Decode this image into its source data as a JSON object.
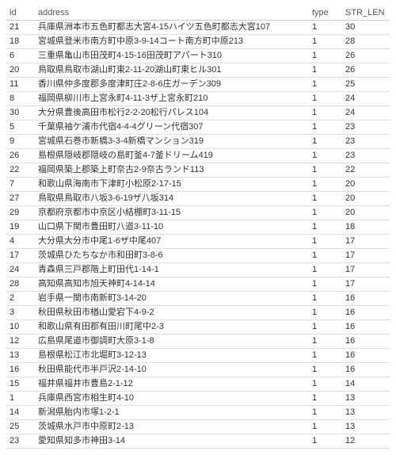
{
  "headers": {
    "id": "id",
    "address": "address",
    "type": "type",
    "strlen": "STR_LEN"
  },
  "rows": [
    {
      "id": "21",
      "address": "兵庫県洲本市五色町都志大宮4-15ハイツ五色町都志大宮107",
      "type": "1",
      "strlen": "30"
    },
    {
      "id": "18",
      "address": "宮城県登米市南方町中原3-9-14コート南方町中原213",
      "type": "1",
      "strlen": "28"
    },
    {
      "id": "6",
      "address": "三重県亀山市田茂町4-15-16田茂町アパート310",
      "type": "1",
      "strlen": "26"
    },
    {
      "id": "20",
      "address": "鳥取県鳥取市湖山町東2-11-20湖山町東ヒル301",
      "type": "1",
      "strlen": "26"
    },
    {
      "id": "11",
      "address": "香川県仲多度郡多度津町庄2-8-6庄ガーデン309",
      "type": "1",
      "strlen": "25"
    },
    {
      "id": "8",
      "address": "福岡県柳川市上宮永町4-11-3ザ上宮永町210",
      "type": "1",
      "strlen": "24"
    },
    {
      "id": "30",
      "address": "大分県豊後高田市松行2-2-20松行パレス104",
      "type": "1",
      "strlen": "24"
    },
    {
      "id": "5",
      "address": "千葉県袖ケ浦市代宿4-4-4グリーン代宿307",
      "type": "1",
      "strlen": "23"
    },
    {
      "id": "9",
      "address": "宮城県石巻市新橋3-3-4新橋マンション319",
      "type": "1",
      "strlen": "23"
    },
    {
      "id": "26",
      "address": "島根県隠岐郡隠岐の島町釜4-7釜ドリーム419",
      "type": "1",
      "strlen": "23"
    },
    {
      "id": "22",
      "address": "福岡県築上郡築上町奈古2-9奈古ランド113",
      "type": "1",
      "strlen": "22"
    },
    {
      "id": "7",
      "address": "和歌山県海南市下津町小松原2-17-15",
      "type": "1",
      "strlen": "20"
    },
    {
      "id": "27",
      "address": "鳥取県鳥取市八坂3-6-19ザ八坂314",
      "type": "1",
      "strlen": "20"
    },
    {
      "id": "29",
      "address": "京都府京都市中京区小結棚町3-11-15",
      "type": "1",
      "strlen": "20"
    },
    {
      "id": "19",
      "address": "山口県下関市豊田町八道3-11-10",
      "type": "1",
      "strlen": "18"
    },
    {
      "id": "4",
      "address": "大分県大分市中尾1-6ザ中尾407",
      "type": "1",
      "strlen": "17"
    },
    {
      "id": "17",
      "address": "茨城県ひたちなか市和田町3-8-6",
      "type": "1",
      "strlen": "17"
    },
    {
      "id": "24",
      "address": "青森県三戸郡階上町田代1-14-1",
      "type": "1",
      "strlen": "17"
    },
    {
      "id": "28",
      "address": "高知県高知市旭天神町4-14-14",
      "type": "1",
      "strlen": "17"
    },
    {
      "id": "2",
      "address": "岩手県一関市南新町3-14-20",
      "type": "1",
      "strlen": "16"
    },
    {
      "id": "3",
      "address": "秋田県秋田市楢山愛宕下4-9-2",
      "type": "1",
      "strlen": "16"
    },
    {
      "id": "10",
      "address": "和歌山県有田郡有田川町尾中2-3",
      "type": "1",
      "strlen": "16"
    },
    {
      "id": "12",
      "address": "広島県尾道市御調町大原3-1-8",
      "type": "1",
      "strlen": "16"
    },
    {
      "id": "13",
      "address": "島根県松江市北堀町3-12-13",
      "type": "1",
      "strlen": "16"
    },
    {
      "id": "16",
      "address": "秋田県能代市半戸沢2-14-10",
      "type": "1",
      "strlen": "16"
    },
    {
      "id": "15",
      "address": "福井県福井市豊島2-1-12",
      "type": "1",
      "strlen": "14"
    },
    {
      "id": "1",
      "address": "兵庫県西宮市相生町4-10",
      "type": "1",
      "strlen": "13"
    },
    {
      "id": "14",
      "address": "新潟県胎内市塚1-2-1",
      "type": "1",
      "strlen": "13"
    },
    {
      "id": "25",
      "address": "茨城県水戸市中原町2-13",
      "type": "1",
      "strlen": "13"
    },
    {
      "id": "23",
      "address": "愛知県知多市神田3-14",
      "type": "1",
      "strlen": "12"
    }
  ]
}
